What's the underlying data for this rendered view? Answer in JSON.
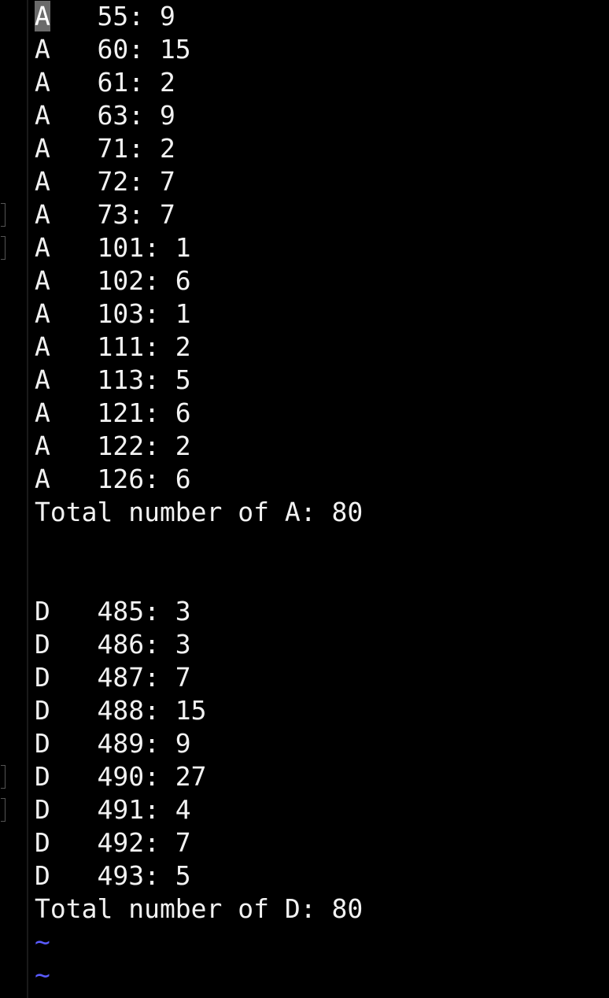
{
  "lines": [
    "A   55: 9",
    "A   60: 15",
    "A   61: 2",
    "A   63: 9",
    "A   71: 2",
    "A   72: 7",
    "A   73: 7",
    "A   101: 1",
    "A   102: 6",
    "A   103: 1",
    "A   111: 2",
    "A   113: 5",
    "A   121: 6",
    "A   122: 2",
    "A   126: 6",
    "Total number of A: 80",
    "",
    "",
    "D   485: 3",
    "D   486: 3",
    "D   487: 7",
    "D   488: 15",
    "D   489: 9",
    "D   490: 27",
    "D   491: 4",
    "D   492: 7",
    "D   493: 5",
    "Total number of D: 80"
  ],
  "cursor": {
    "char": "A",
    "rest_of_first_line": "   55: 9"
  },
  "empty_line_marker": "~",
  "colors": {
    "background": "#000000",
    "text": "#f2f2f2",
    "tilde": "#5a5bff",
    "cursor": "#6b6b6b"
  }
}
